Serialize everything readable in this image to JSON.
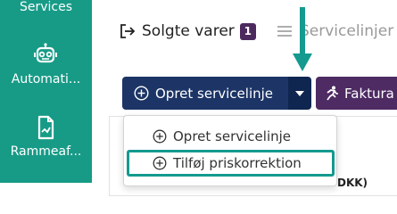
{
  "sidebar": {
    "items": [
      {
        "label": "Services",
        "icon": "services-icon"
      },
      {
        "label": "Automati...",
        "icon": "robot-icon"
      },
      {
        "label": "Rammeaf...",
        "icon": "document-icon"
      }
    ],
    "background": "#179b87"
  },
  "tabs": [
    {
      "label": "Solgte varer",
      "count": "1",
      "icon": "export-icon"
    },
    {
      "label": "Servicelinjer",
      "icon": "list-icon"
    }
  ],
  "toolbar": {
    "create_label": "Opret servicelinje",
    "faktura_label": "Faktura",
    "create_color": "#1c3566",
    "faktura_color": "#4e2b63"
  },
  "dropdown": {
    "items": [
      {
        "label": "Opret servicelinje",
        "icon": "plus-circle-icon"
      },
      {
        "label": "Tilføj priskorrektion",
        "icon": "plus-circle-icon"
      }
    ],
    "highlight_color": "#149a8f"
  },
  "table": {
    "partial_header": "DKK)"
  }
}
